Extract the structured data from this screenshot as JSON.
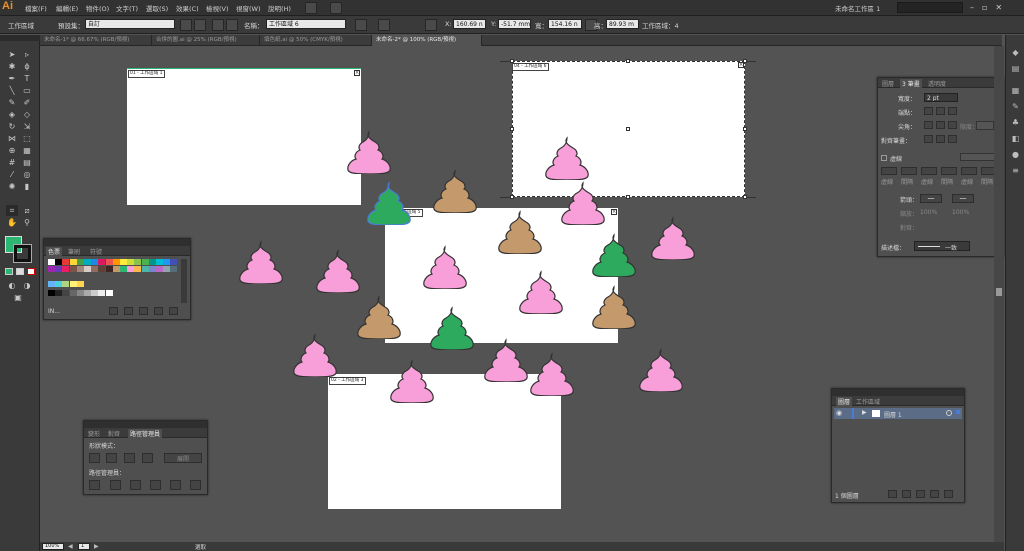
{
  "app": {
    "logo": "Ai",
    "doc_title": "未命名工作區 1",
    "search_placeholder": ""
  },
  "menu": [
    "檔案(F)",
    "編輯(E)",
    "物件(O)",
    "文字(T)",
    "選取(S)",
    "效果(C)",
    "檢視(V)",
    "視窗(W)",
    "說明(H)"
  ],
  "control": {
    "mode_label": "工作區域",
    "preset_label": "預設集：",
    "preset_value": "自訂",
    "name_label": "名稱：",
    "name_value": "工作區域 6",
    "x_label": "X:",
    "x_value": "160.69 n",
    "y_label": "Y:",
    "y_value": "-51.7 mm",
    "w_label": "寬：",
    "w_value": "154.16 n",
    "h_label": "高：",
    "h_value": "89.93 m",
    "artboard_count": "工作區域：4"
  },
  "tabs": [
    "未命名-1* @ 66.67% (RGB/預視)",
    "合併的圖.ai @ 25% (RGB/預視)",
    "填色紙.ai @ 50% (CMYK/預視)",
    "未命名-2* @ 100% (RGB/預視)"
  ],
  "artboards": [
    {
      "label": "01 - 工作區域 1"
    },
    {
      "label": "01 - 工作區域 5"
    },
    {
      "label": "02 - 工作區域 3"
    },
    {
      "label": "04 - 工作區域 6"
    }
  ],
  "colors": {
    "pink": "#f89fd9",
    "brown": "#c49a6c",
    "green": "#2eaa5e",
    "selection": "#4a7bd8",
    "fill": "#2bb673"
  },
  "swatches_panel": {
    "tabs": [
      "色票",
      "筆刷",
      "符號"
    ],
    "footer": "IN..."
  },
  "stroke_panel": {
    "tabs": [
      "圖層",
      "3 筆畫",
      "透明度"
    ],
    "weight_label": "寬度：",
    "weight_value": "2 pt",
    "cap_label": "端點：",
    "corner_label": "尖角：",
    "limit_label": "限度：",
    "align_label": "對齊筆畫：",
    "dashed_label": "虛線",
    "dash_labels": [
      "虛線",
      "間隔",
      "虛線",
      "間隔",
      "虛線",
      "間隔"
    ],
    "arrow_label": "箭頭：",
    "scale_label": "縮放：",
    "scale_values": [
      "100%",
      "100%"
    ],
    "align2_label": "對齊：",
    "profile_label": "描述檔：",
    "profile_value": "一致"
  },
  "pathfinder_panel": {
    "tabs": [
      "變形",
      "對齊",
      "路徑管理員"
    ],
    "shape_modes": "形狀模式：",
    "expand": "展開",
    "pathfinders": "路徑管理員："
  },
  "layers_panel": {
    "tabs": [
      "圖層",
      "工作區域"
    ],
    "layer_name": "圖層 1",
    "footer": "1 個圖層"
  },
  "status": {
    "zoom": "100%",
    "artboard_num": "1",
    "tool": "選取"
  }
}
